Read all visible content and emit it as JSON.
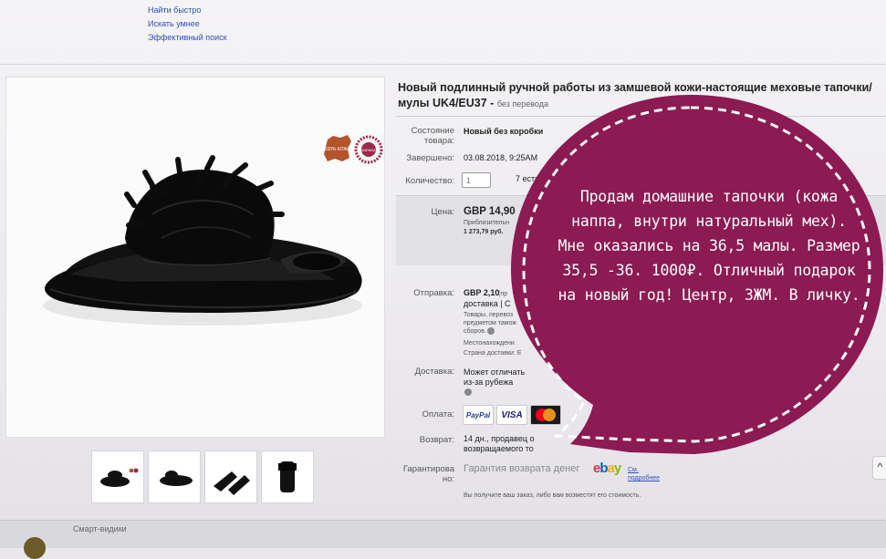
{
  "top_menu": {
    "items": [
      "Найти быстро",
      "Искать умнее",
      "Эффективный поиск"
    ]
  },
  "listing": {
    "title": "Новый подлинный ручной работы из замшевой кожи-настоящие меховые тапочки/мулы UK4/EU37 -",
    "translation_note": "без перевода",
    "condition_label": "Состояние товара:",
    "condition_value": "Новый без коробки",
    "ended_label": "Завершено:",
    "ended_value": "03.08.2018, 9:25AM",
    "quantity_label": "Количество:",
    "quantity_value": "1",
    "available_text": "7 есть",
    "price_label": "Цена:",
    "price_value": "GBP 14,90",
    "price_approx": "Приблизительн",
    "price_rub": "1 273,79 руб.",
    "shipping_label": "Отправка:",
    "shipping_value": "GBP 2,10",
    "shipping_note_1": "(пр",
    "shipping_type": "доставка | С",
    "shipping_small_1": "Товары, перевоз",
    "shipping_small_2": "предметом тамож",
    "shipping_small_3": "сборов.",
    "shipping_small_4": "Местонахождени",
    "shipping_small_5": "Страна доставки: Е",
    "delivery_label": "Доставка:",
    "delivery_value_1": "Может отличать",
    "delivery_value_2": "из-за рубежа",
    "payment_label": "Оплата:",
    "payment_methods": [
      "PayPal",
      "VISA",
      "MasterCard"
    ],
    "return_label": "Возврат:",
    "return_value_1": "14 дн., продавец о",
    "return_value_2": "возвращаемого то",
    "guarantee_label_1": "Гарантирова",
    "guarantee_label_2": "но:",
    "guarantee_value": "Гарантия возврата денег",
    "guarantee_brand": "ebay",
    "guarantee_link": "См. подробнее",
    "guarantee_note": "Вы получите ваш заказ, либо вам возместят его стоимость."
  },
  "badges": {
    "leather_badge": "100% КОЖА",
    "handmade_badge": "HANDMADE"
  },
  "bottom_bar": {
    "label": "Смарт-видики"
  },
  "overlay": {
    "text": "Продам домашние тапочки (кожа наппа, внутри натуральный мех). Мне оказались на 36,5 малы. Размер 35,5 -36. 1000₽. Отличный подарок на новый год! Центр, 3ЖМ. В личку.",
    "color": "#8c1a53"
  },
  "colors": {
    "link": "#2f4fbf",
    "bubble": "#8c1a53",
    "ebay_red": "#e53238",
    "ebay_blue": "#0064d2",
    "ebay_yellow": "#f5af02",
    "ebay_green": "#86b817"
  }
}
